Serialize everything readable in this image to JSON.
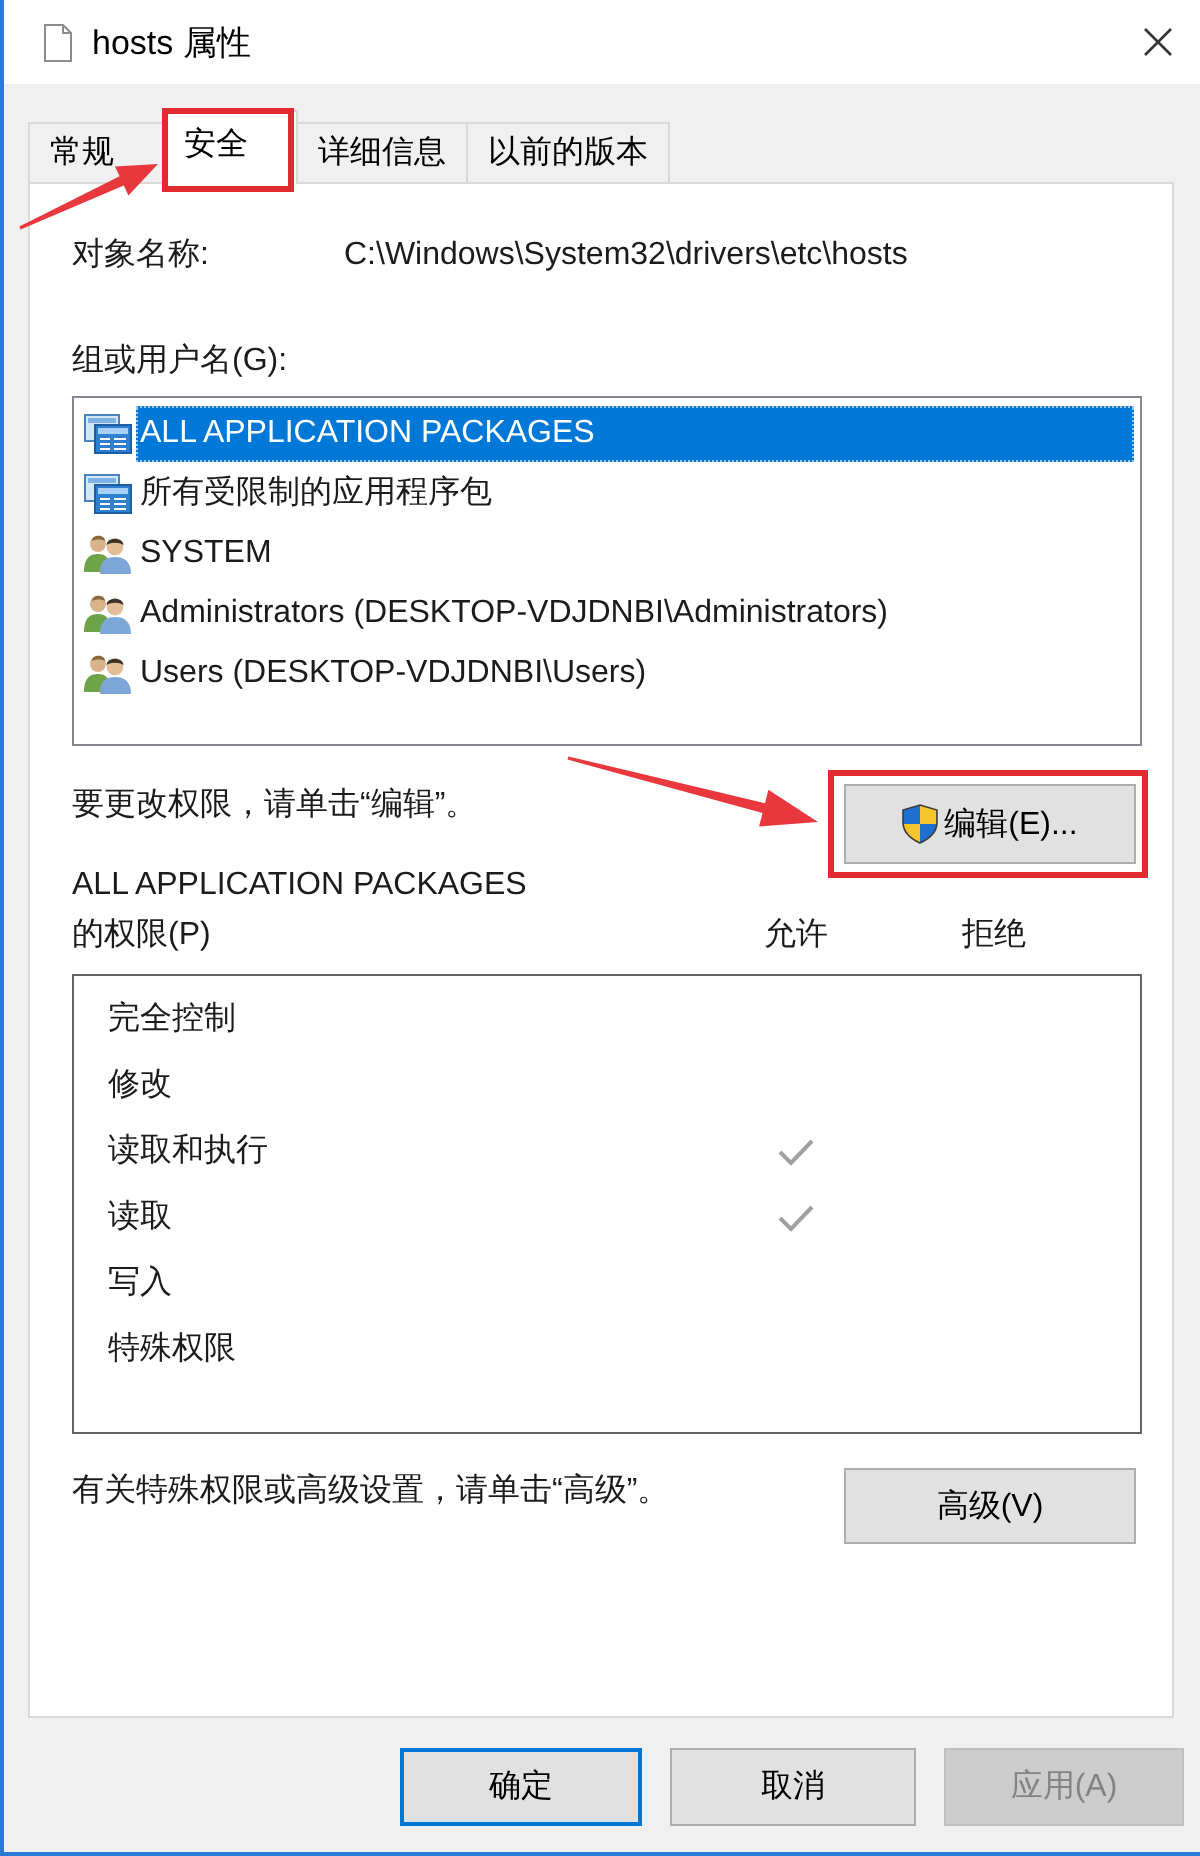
{
  "window": {
    "title": "hosts 属性"
  },
  "tabs": [
    {
      "label": "常规",
      "selected": false,
      "highlighted": false
    },
    {
      "label": "安全",
      "selected": true,
      "highlighted": true
    },
    {
      "label": "详细信息",
      "selected": false,
      "highlighted": false
    },
    {
      "label": "以前的版本",
      "selected": false,
      "highlighted": false
    }
  ],
  "object_name": {
    "label": "对象名称:",
    "value": "C:\\Windows\\System32\\drivers\\etc\\hosts"
  },
  "groups": {
    "label": "组或用户名(G):",
    "items": [
      {
        "name": "ALL APPLICATION PACKAGES",
        "kind": "package",
        "selected": true
      },
      {
        "name": "所有受限制的应用程序包",
        "kind": "package",
        "selected": false
      },
      {
        "name": "SYSTEM",
        "kind": "group",
        "selected": false
      },
      {
        "name": "Administrators (DESKTOP-VDJDNBI\\Administrators)",
        "kind": "group",
        "selected": false
      },
      {
        "name": "Users (DESKTOP-VDJDNBI\\Users)",
        "kind": "group",
        "selected": false
      }
    ]
  },
  "edit_hint": "要更改权限，请单击“编辑”。",
  "edit_button": {
    "label": "编辑(E)...",
    "highlighted": true
  },
  "permissions": {
    "title": "ALL APPLICATION PACKAGES",
    "label": "的权限(P)",
    "columns": [
      "允许",
      "拒绝"
    ],
    "rows": [
      {
        "name": "完全控制",
        "allow": false,
        "deny": false
      },
      {
        "name": "修改",
        "allow": false,
        "deny": false
      },
      {
        "name": "读取和执行",
        "allow": true,
        "deny": false
      },
      {
        "name": "读取",
        "allow": true,
        "deny": false
      },
      {
        "name": "写入",
        "allow": false,
        "deny": false
      },
      {
        "name": "特殊权限",
        "allow": false,
        "deny": false
      }
    ]
  },
  "advanced_hint": "有关特殊权限或高级设置，请单击“高级”。",
  "advanced_button": {
    "label": "高级(V)"
  },
  "buttons": [
    {
      "label": "确定",
      "default": true,
      "disabled": false
    },
    {
      "label": "取消",
      "default": false,
      "disabled": false
    },
    {
      "label": "应用(A)",
      "default": false,
      "disabled": true
    }
  ]
}
